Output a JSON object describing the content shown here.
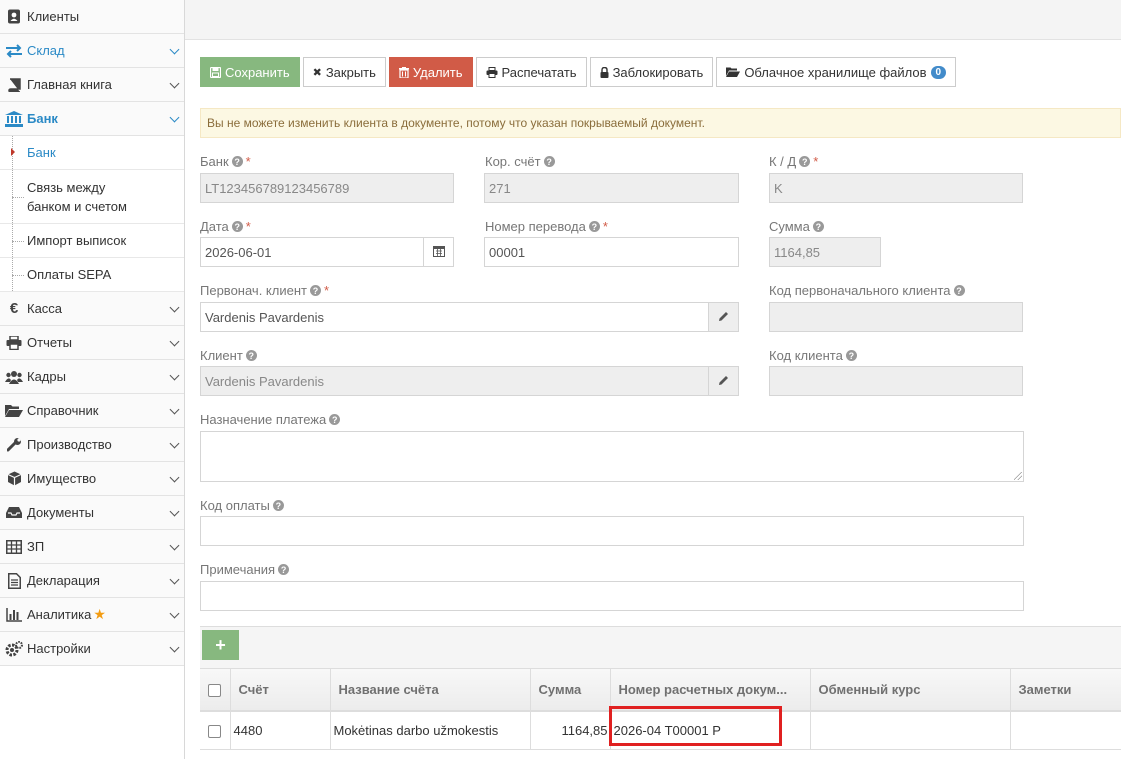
{
  "sidebar": {
    "items": [
      {
        "label": "Клиенты",
        "icon": "address-book-icon"
      },
      {
        "label": "Склад",
        "icon": "exchange-icon"
      },
      {
        "label": "Главная книга",
        "icon": "book-icon"
      },
      {
        "label": "Банк",
        "icon": "bank-icon"
      },
      {
        "label": "Касса",
        "icon": "euro-icon"
      },
      {
        "label": "Отчеты",
        "icon": "print-icon"
      },
      {
        "label": "Кадры",
        "icon": "users-icon"
      },
      {
        "label": "Справочник",
        "icon": "folder-open-icon"
      },
      {
        "label": "Производство",
        "icon": "wrench-icon"
      },
      {
        "label": "Имущество",
        "icon": "cube-icon"
      },
      {
        "label": "Документы",
        "icon": "inbox-icon"
      },
      {
        "label": "ЗП",
        "icon": "table-icon"
      },
      {
        "label": "Декларация",
        "icon": "file-text-icon"
      },
      {
        "label": "Аналитика",
        "icon": "bar-chart-icon"
      },
      {
        "label": "Настройки",
        "icon": "cogs-icon"
      }
    ],
    "bank_sub": [
      {
        "label": "Банк"
      },
      {
        "label": "Связь между банком и счетом"
      },
      {
        "label": "Импорт выписок"
      },
      {
        "label": "Оплаты SEPA"
      }
    ]
  },
  "toolbar": {
    "save": "Сохранить",
    "close": "Закрыть",
    "delete": "Удалить",
    "print": "Распечатать",
    "lock": "Заблокировать",
    "cloud": "Облачное хранилище файлов",
    "cloud_count": "0"
  },
  "alert": "Вы не можете изменить клиента в документе, потому что указан покрываемый документ.",
  "form": {
    "bank_label": "Банк",
    "bank_value": "LT123456789123456789",
    "corr_label": "Кор. счёт",
    "corr_value": "271",
    "kd_label": "К / Д",
    "kd_value": "K",
    "date_label": "Дата",
    "date_value": "2026-06-01",
    "transfer_label": "Номер перевода",
    "transfer_value": "00001",
    "sum_label": "Сумма",
    "sum_value": "1164,85",
    "orig_client_label": "Первонач. клиент",
    "orig_client_value": "Vardenis Pavardenis",
    "orig_client_code_label": "Код первоначального клиента",
    "client_label": "Клиент",
    "client_value": "Vardenis Pavardenis",
    "client_code_label": "Код клиента",
    "purpose_label": "Назначение платежа",
    "pay_code_label": "Код оплаты",
    "notes_label": "Примечания"
  },
  "grid": {
    "headers": [
      "Счёт",
      "Название счёта",
      "Сумма",
      "Номер расчетных докум...",
      "Обменный курс",
      "Заметки"
    ],
    "rows": [
      {
        "account": "4480",
        "name": "Mokėtinas darbo užmokestis",
        "amount": "1164,85",
        "doc": "2026-04 T00001 P",
        "rate": "",
        "notes": ""
      }
    ]
  },
  "colors": {
    "accent": "#2b8ac6",
    "success": "#87b87f",
    "danger": "#d15b47",
    "highlight": "#e02020"
  }
}
